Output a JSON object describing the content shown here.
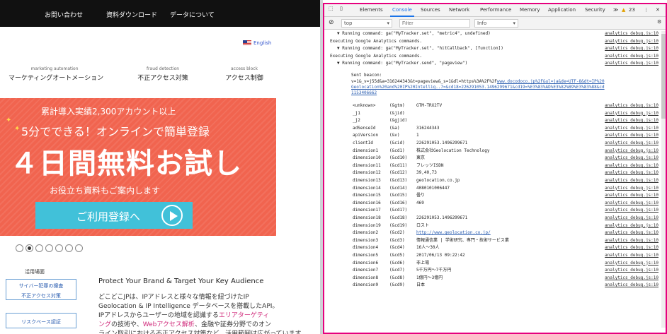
{
  "site": {
    "nav": [
      "お問い合わせ",
      "資料ダウンロード",
      "データについて"
    ],
    "lang": "English",
    "categories": [
      {
        "en": "marketing automation",
        "ja": "マーケティングオートメーション"
      },
      {
        "en": "fraud detection",
        "ja": "不正アクセス対策"
      },
      {
        "en": "access block",
        "ja": "アクセス制御"
      }
    ],
    "banner": {
      "line1": "累計導入実績2,300アカウント以上",
      "line2": "5分でできる！オンラインで簡単登録",
      "line3": "４日間無料お試し",
      "line4": "お役立ち資料もご案内します",
      "cta": "ご利用登録へ"
    },
    "slider": {
      "count": 7,
      "active": 1
    },
    "usecase_title": "活用場面",
    "side_buttons": [
      "サイバー犯罪の捜査",
      "不正アクセス対策",
      "リスクベース認証"
    ],
    "protect_title": "Protect Your Brand & Target Your Key Audience",
    "paragraph": [
      {
        "text": "どこどこJPは、IPアドレスと様々な情報を紐づけたIP"
      },
      {
        "text": "Geolocation & IP Intelligence データベースを搭載したAPI。"
      },
      {
        "pre": "IPアドレスからユーザーの地域を認識する",
        "pink": "エリアターゲティ"
      },
      {
        "pink": "ング",
        "mid": "の技術や、",
        "pink2": "Webアクセス解析",
        "post": "、金融や証券分野でのオン"
      },
      {
        "text": "ライン取引における不正アクセス対策など、活用範囲は広がっています。"
      }
    ]
  },
  "devtools": {
    "tabs": [
      "Elements",
      "Console",
      "Sources",
      "Network",
      "Performance",
      "Memory",
      "Application",
      "Security"
    ],
    "active_tab": "Console",
    "more_tabs": "≫",
    "warnings": "23",
    "context": "top",
    "filter_placeholder": "Filter",
    "level": "Info",
    "source_link": "analytics_debug.js:10",
    "log": [
      {
        "text": "▼ Running command: ga(\"MyTracker.set\", \"metric4\", undefined)",
        "indent": 1
      },
      {
        "text": "Executing Google Analytics commands.",
        "indent": 0
      },
      {
        "text": "▼ Running command: ga(\"MyTracker.set\", \"hitCallback\", [function])",
        "indent": 1
      },
      {
        "text": "Executing Google Analytics commands.",
        "indent": 0
      },
      {
        "text": "▼ Running command: ga(\"MyTracker.send\", \"pageview\")",
        "indent": 1
      }
    ],
    "beacon": {
      "label": "Sent beacon:",
      "line1_pre": "v=1&_v=j55d&a=316244343&t=pageview&_s=1&dl=https%3A%2F%2F",
      "line1_link": "www.docodoco.jp%2F&ul=ja&de=UTF-8&dt=IP%20",
      "line2": "Geolocation%20and%20IP%20Intellig..7=&cd18=226291053.1496299671&cd19=%E3%83%AD%E3%82%B9%E3%83%88&cd",
      "line3": "1153406662"
    },
    "params": [
      {
        "key": "<unknown>",
        "code": "(&gtm)",
        "value": "GTM-TRX2TV"
      },
      {
        "key": "_j1",
        "code": "(&jid)",
        "value": ""
      },
      {
        "key": "_j2",
        "code": "(&gjid)",
        "value": ""
      },
      {
        "key": "adSenseId",
        "code": "(&a)",
        "value": "316244343"
      },
      {
        "key": "apiVersion",
        "code": "(&v)",
        "value": "1"
      },
      {
        "key": "clientId",
        "code": "(&cid)",
        "value": "226291053.1496299671"
      },
      {
        "key": "dimension1",
        "code": "(&cd1)",
        "value": "株式会社Geolocation Technology"
      },
      {
        "key": "dimension10",
        "code": "(&cd10)",
        "value": "東京"
      },
      {
        "key": "dimension11",
        "code": "(&cd11)",
        "value": "フレッツISDN"
      },
      {
        "key": "dimension12",
        "code": "(&cd12)",
        "value": "39,40,73"
      },
      {
        "key": "dimension13",
        "code": "(&cd13)",
        "value": "geolocation.co.jp"
      },
      {
        "key": "dimension14",
        "code": "(&cd14)",
        "value": "4080101006447"
      },
      {
        "key": "dimension15",
        "code": "(&cd15)",
        "value": "曇り"
      },
      {
        "key": "dimension16",
        "code": "(&cd16)",
        "value": "469"
      },
      {
        "key": "dimension17",
        "code": "(&cd17)",
        "value": ""
      },
      {
        "key": "dimension18",
        "code": "(&cd18)",
        "value": "226291053.1496299671"
      },
      {
        "key": "dimension19",
        "code": "(&cd19)",
        "value": "ロスト"
      },
      {
        "key": "dimension2",
        "code": "(&cd2)",
        "value": "http://www.geolocation.co.jp/",
        "link": true
      },
      {
        "key": "dimension3",
        "code": "(&cd3)",
        "value": "情報通信業 | 学術研究、専門・技術サービス業"
      },
      {
        "key": "dimension4",
        "code": "(&cd4)",
        "value": "16人〜30人"
      },
      {
        "key": "dimension5",
        "code": "(&cd5)",
        "value": "2017/06/13 09:22:42"
      },
      {
        "key": "dimension6",
        "code": "(&cd6)",
        "value": "非上場"
      },
      {
        "key": "dimension7",
        "code": "(&cd7)",
        "value": "5千万円〜7千万円"
      },
      {
        "key": "dimension8",
        "code": "(&cd8)",
        "value": "1億円〜3億円"
      },
      {
        "key": "dimension9",
        "code": "(&cd9)",
        "value": "日本"
      }
    ]
  },
  "colors": {
    "banner": "#f1644f",
    "cta": "#41c1d9",
    "highlight_frame": "#e6007e",
    "devtools_accent": "#1a73e8"
  }
}
